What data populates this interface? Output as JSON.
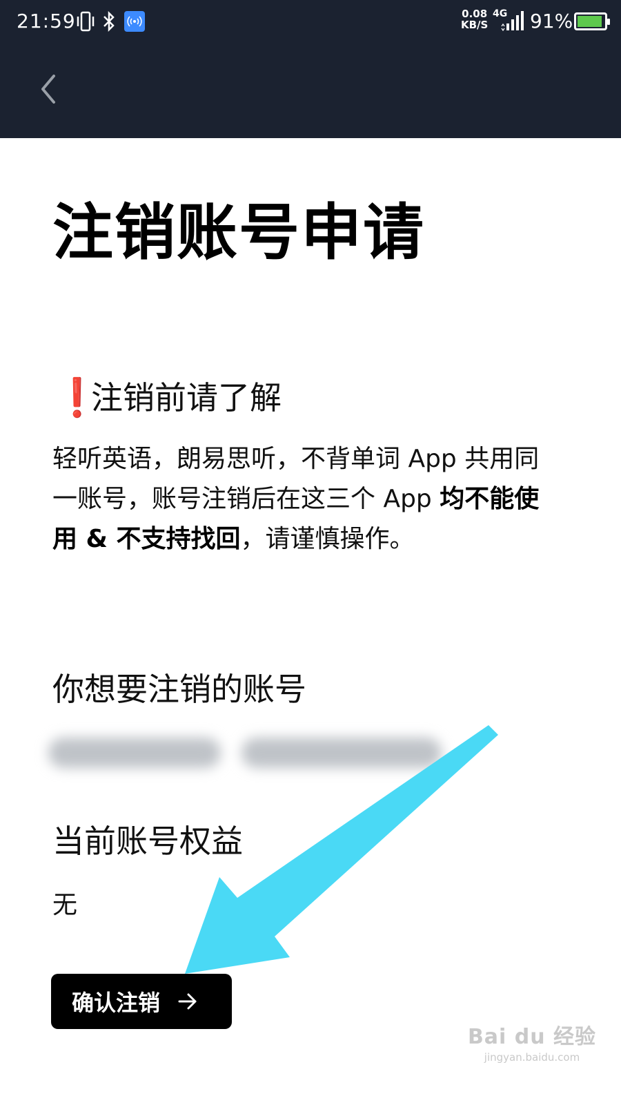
{
  "status_bar": {
    "time": "21:59",
    "net_speed_value": "0.08",
    "net_speed_unit": "KB/S",
    "network_type": "4G",
    "battery_percent": "91%",
    "battery_level": 0.91
  },
  "page": {
    "title": "注销账号申请"
  },
  "notice": {
    "heading": "注销前请了解",
    "text_part1": "轻听英语，朗易思听，不背单词 App 共用同一账号，账号注销后在这三个 App ",
    "text_bold": "均不能使用 & 不支持找回",
    "text_part2": "，请谨慎操作。"
  },
  "account_section": {
    "heading": "你想要注销的账号"
  },
  "benefit_section": {
    "heading": "当前账号权益",
    "value": "无"
  },
  "confirm_button": {
    "label": "确认注销"
  },
  "watermark": {
    "logo": "Bai du 经验",
    "url": "jingyan.baidu.com"
  },
  "colors": {
    "header_bg": "#1b2230",
    "button_bg": "#000000",
    "pointer_arrow": "#4ad9f5",
    "warning": "#e02424"
  }
}
